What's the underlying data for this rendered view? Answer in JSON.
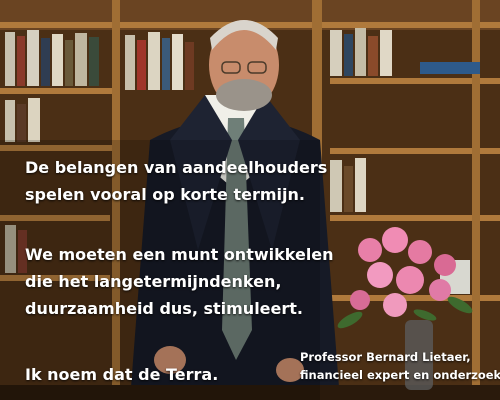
{
  "quote": {
    "block1": [
      "De belangen van aandeelhouders",
      "spelen vooral op korte termijn."
    ],
    "block2": [
      "We moeten een munt ontwikkelen",
      "die het langetermijndenken,",
      "duurzaamheid dus, stimuleert."
    ],
    "block3": "Ik noem dat de Terra."
  },
  "credit": {
    "name": "Professor Bernard Lietaer,",
    "role": "financieel expert en onderzoeker"
  }
}
